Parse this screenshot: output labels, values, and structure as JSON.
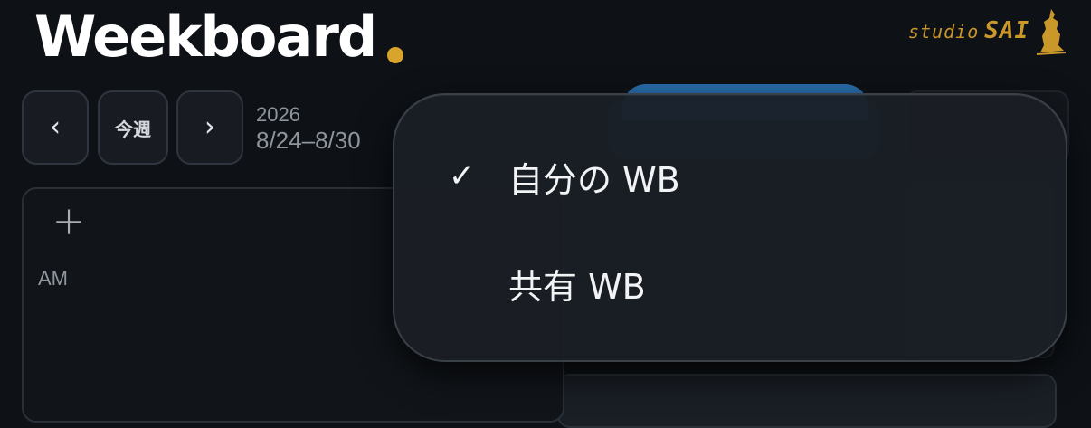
{
  "header": {
    "app_title": "Weekboard",
    "logo_dot_color": "#d9a42c",
    "brand": {
      "prefix": "studio",
      "name": "SAI",
      "color": "#c9972a"
    }
  },
  "nav": {
    "prev_icon": "‹",
    "today_label": "今週",
    "next_icon": "›",
    "year": "2026",
    "range": "8/24–8/30"
  },
  "day_panel": {
    "add_icon": "+",
    "period_label": "AM"
  },
  "menu": {
    "check_icon": "✓",
    "items": [
      {
        "label": "自分の WB",
        "selected": true
      },
      {
        "label": "共有 WB",
        "selected": false
      }
    ]
  }
}
